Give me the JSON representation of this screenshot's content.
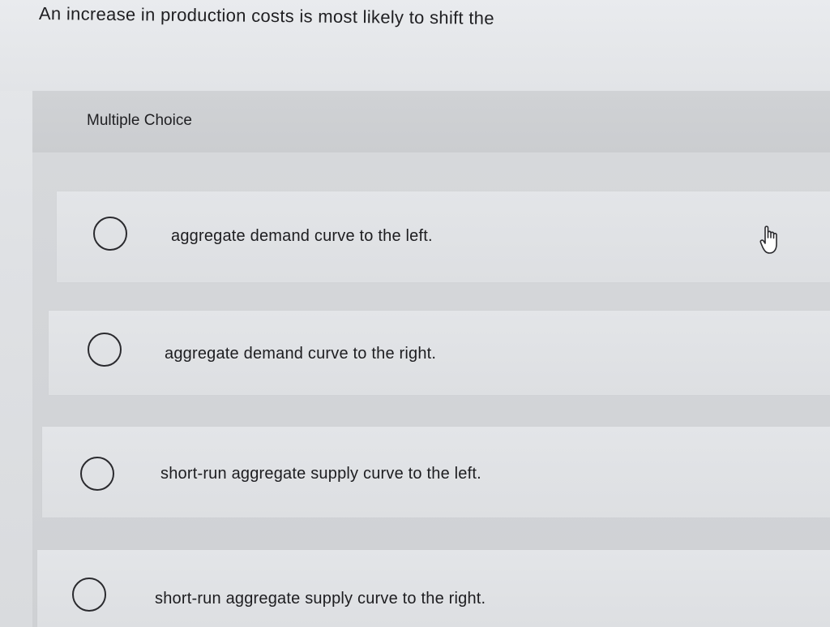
{
  "question": {
    "text": "An increase in production costs is most likely to shift the"
  },
  "choices_header": {
    "label": "Multiple Choice"
  },
  "options": [
    {
      "label": "aggregate demand curve to the left."
    },
    {
      "label": "aggregate demand curve to the right."
    },
    {
      "label": "short-run aggregate supply curve to the left."
    },
    {
      "label": "short-run aggregate supply curve to the right."
    }
  ],
  "cursor": {
    "icon": "hand-pointer-icon"
  }
}
